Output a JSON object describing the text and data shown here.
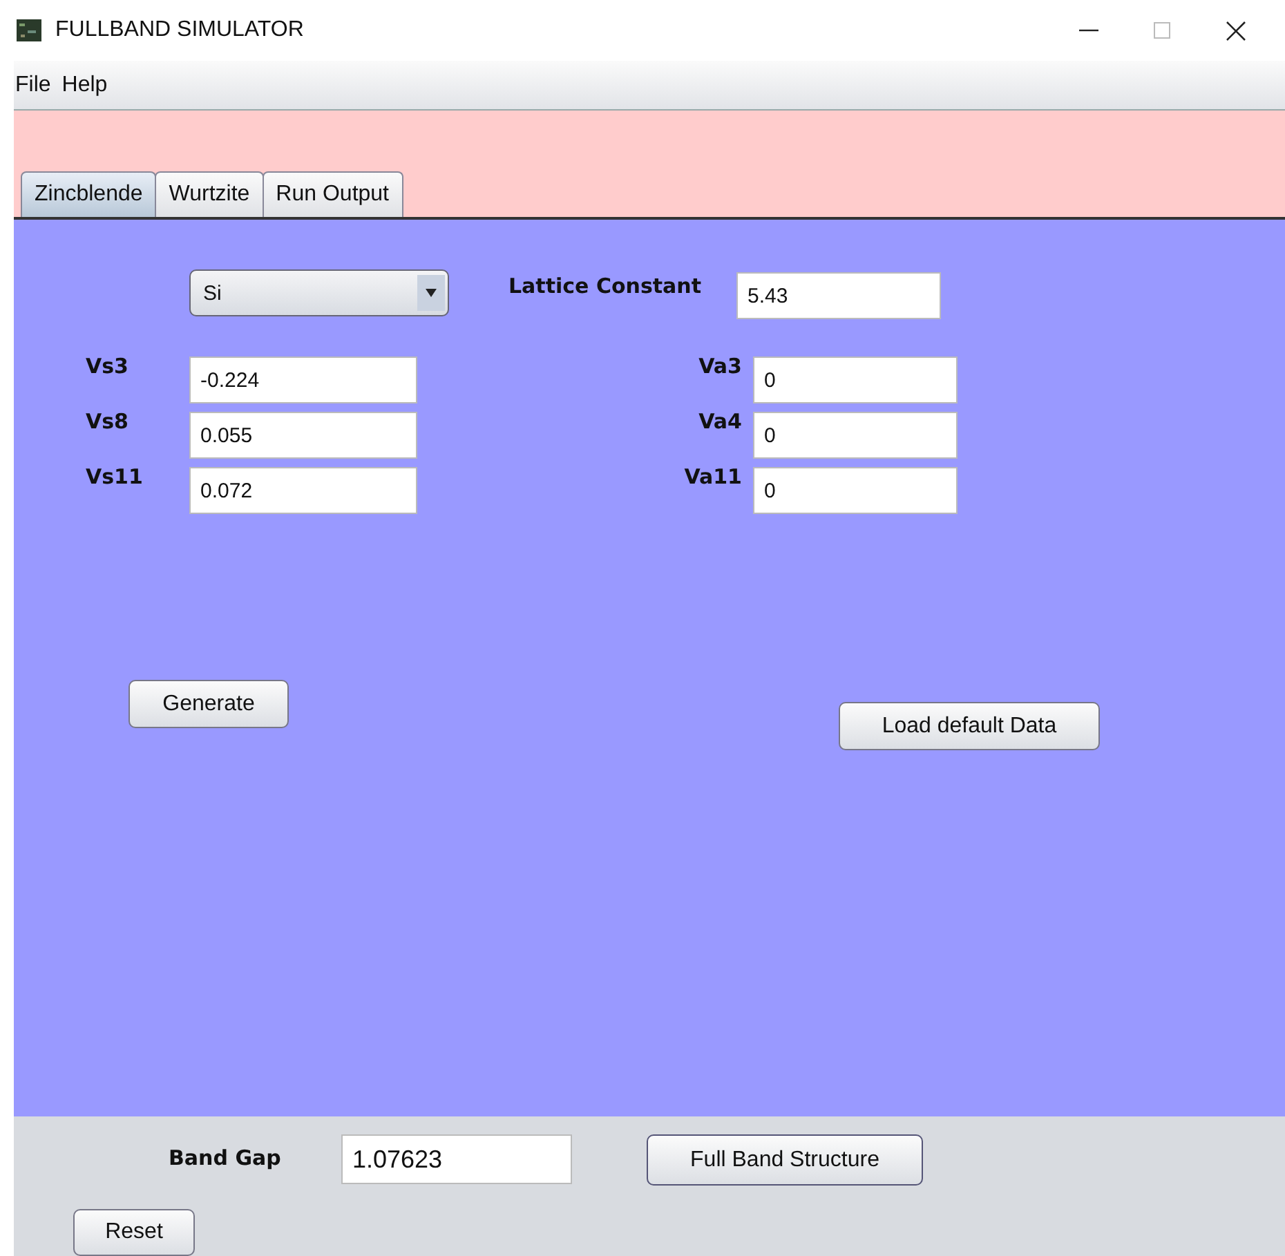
{
  "window": {
    "title": "FULLBAND SIMULATOR"
  },
  "menu": [
    "File",
    "Help"
  ],
  "tabs": [
    {
      "label": "Zincblende",
      "selected": true
    },
    {
      "label": "Wurtzite",
      "selected": false
    },
    {
      "label": "Run Output",
      "selected": false
    }
  ],
  "material": {
    "value": "Si"
  },
  "lattice_constant": {
    "label": "Lattice Constant",
    "value": "5.43"
  },
  "symmetric_params": [
    {
      "label": "Vs3",
      "value": "-0.224"
    },
    {
      "label": "Vs8",
      "value": "0.055"
    },
    {
      "label": "Vs11",
      "value": "0.072"
    }
  ],
  "antisymmetric_params": [
    {
      "label": "Va3",
      "value": "0"
    },
    {
      "label": "Va4",
      "value": "0"
    },
    {
      "label": "Va11",
      "value": "0"
    }
  ],
  "generate_button": "Generate",
  "load_default_button": "Load default Data",
  "band_gap": {
    "label": "Band Gap",
    "value": "1.07623"
  },
  "full_band_button": "Full Band Structure",
  "reset_button": "Reset"
}
